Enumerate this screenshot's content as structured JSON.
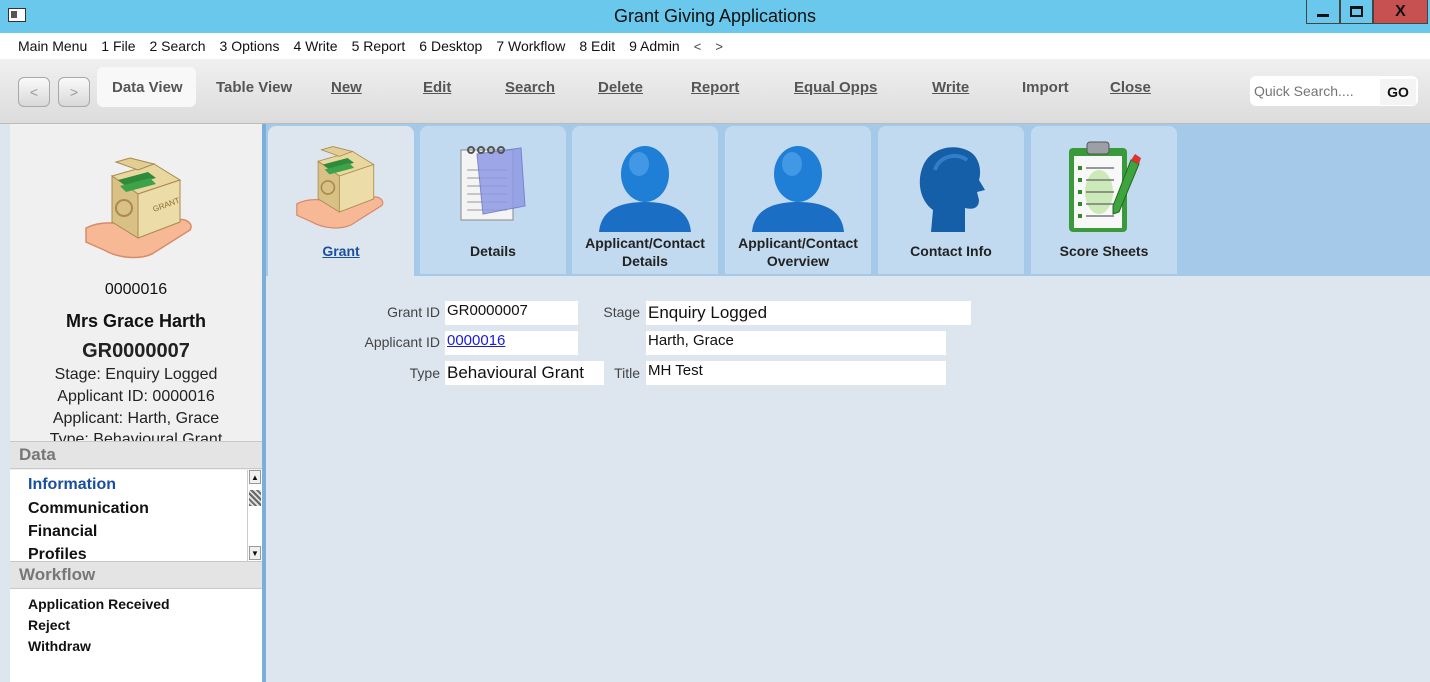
{
  "window": {
    "title": "Grant Giving Applications"
  },
  "menu": [
    "Main Menu",
    "1 File",
    "2 Search",
    "3 Options",
    "4 Write",
    "5 Report",
    "6 Desktop",
    "7 Workflow",
    "8 Edit",
    "9 Admin"
  ],
  "menu_arrows": [
    "<",
    ">"
  ],
  "toolbar": {
    "data_view": "Data View",
    "table_view": "Table View",
    "new": "New",
    "edit": "Edit",
    "search": "Search",
    "delete": "Delete",
    "report": "Report",
    "equal_opps": "Equal Opps",
    "write": "Write",
    "import": "Import",
    "close": "Close",
    "quick_search_placeholder": "Quick Search....",
    "go": "GO"
  },
  "summary": {
    "number": "0000016",
    "name": "Mrs Grace Harth",
    "reference": "GR0000007",
    "stage": "Stage: Enquiry Logged",
    "applicant_id": "Applicant ID: 0000016",
    "applicant": "Applicant: Harth, Grace",
    "type": "Type: Behavioural Grant"
  },
  "data_section": {
    "heading": "Data",
    "items": [
      "Information",
      "Communication",
      "Financial",
      "Profiles"
    ]
  },
  "workflow_section": {
    "heading": "Workflow",
    "items": [
      "Application Received",
      "Reject",
      "Withdraw"
    ]
  },
  "tabs": {
    "grant": "Grant",
    "details": "Details",
    "applicant_details_1": "Applicant/Contact",
    "applicant_details_2": "Details",
    "applicant_overview_1": "Applicant/Contact",
    "applicant_overview_2": "Overview",
    "contact_info": "Contact Info",
    "score_sheets": "Score Sheets"
  },
  "form": {
    "grant_id_label": "Grant ID",
    "grant_id": "GR0000007",
    "applicant_id_label": "Applicant ID",
    "applicant_id": "0000016",
    "type_label": "Type",
    "type": "Behavioural Grant",
    "stage_label": "Stage",
    "stage": "Enquiry Logged",
    "applicant_name": "Harth, Grace",
    "title_label": "Title",
    "title": "MH Test"
  },
  "colors": {
    "titlebar": "#6ac8ec",
    "tab_strip": "#a5c9e8",
    "tab": "#c2daf0",
    "content_bg": "#dde6ef",
    "link": "#1a1adc",
    "active_nav": "#1a4f9c",
    "close_button": "#c75050"
  },
  "icons": [
    "app-icon",
    "grant-box-icon",
    "notepad-icon",
    "person-icon",
    "head-profile-icon",
    "clipboard-icon",
    "back-arrow-icon",
    "forward-arrow-icon"
  ]
}
